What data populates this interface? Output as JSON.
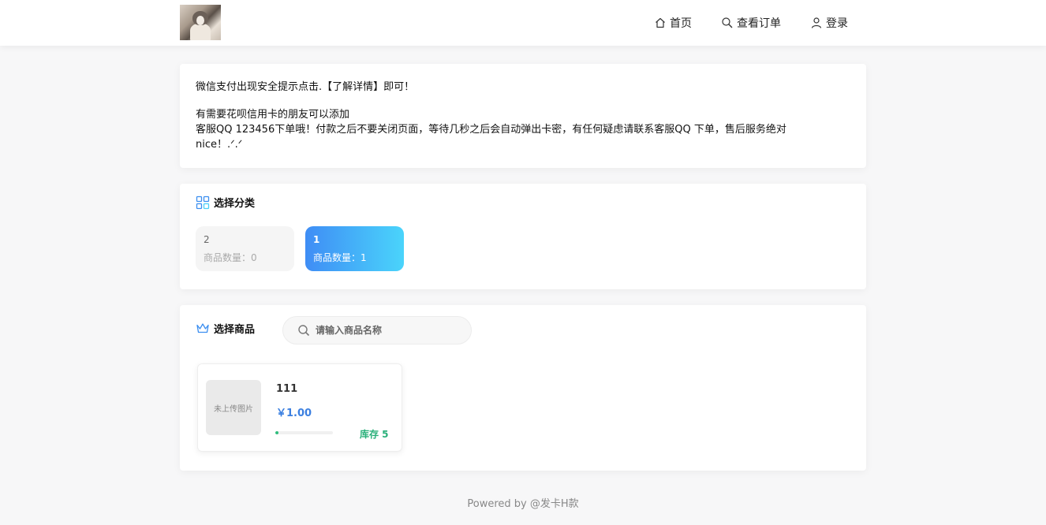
{
  "nav": {
    "home": "首页",
    "orders": "查看订单",
    "login": "登录"
  },
  "notice": {
    "line1": "微信支付出现安全提示点击.【了解详情】即可！",
    "line2": "有需要花呗信用卡的朋友可以添加",
    "line3": "客服QQ 123456下单哦！付款之后不要关闭页面，等待几秒之后会自动弹出卡密，有任何疑虑请联系客服QQ 下单，售后服务绝对",
    "line4": "nice！.ᐟ.ᐟ"
  },
  "categories": {
    "title": "选择分类",
    "items": [
      {
        "name": "2",
        "count": "商品数量：0"
      },
      {
        "name": "1",
        "count": "商品数量：1"
      }
    ]
  },
  "goods": {
    "title": "选择商品",
    "search_placeholder": "请输入商品名称",
    "items": [
      {
        "thumb_text": "未上传图片",
        "name": "111",
        "price": "￥1.00",
        "stock": "库存 5",
        "stock_level": 0.05
      }
    ]
  },
  "footer": "Powered by @发卡H款",
  "colors": {
    "accent": "#3b7fe0",
    "stock": "#2ab07a",
    "category_gradient_start": "#3f8df5",
    "category_gradient_end": "#4ad4fb"
  }
}
